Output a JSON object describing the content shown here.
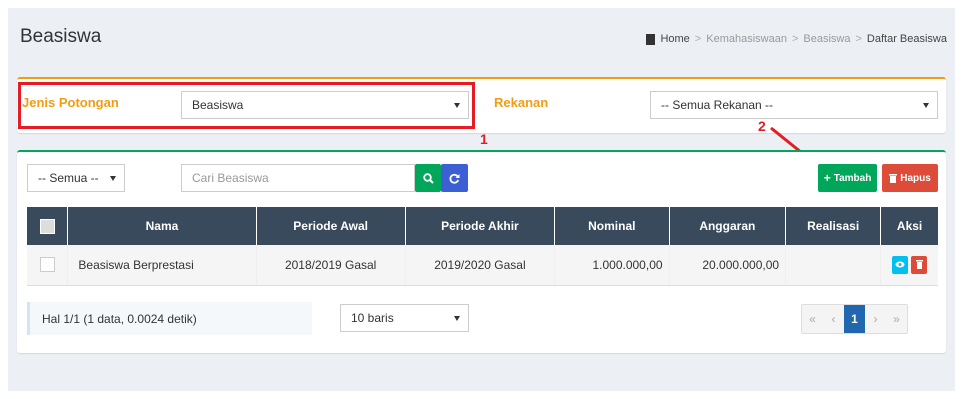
{
  "page": {
    "title": "Beasiswa",
    "breadcrumb": [
      "Home",
      "Kemahasiswaan",
      "Beasiswa",
      "Daftar Beasiswa"
    ]
  },
  "filter": {
    "jenis_label": "Jenis Potongan",
    "jenis_value": "Beasiswa",
    "rekanan_label": "Rekanan",
    "rekanan_value": "-- Semua Rekanan --"
  },
  "annotations": {
    "one": "1",
    "two": "2"
  },
  "toolbar": {
    "semua_value": "-- Semua --",
    "search_placeholder": "Cari Beasiswa",
    "tambah_label": "Tambah",
    "hapus_label": "Hapus"
  },
  "table": {
    "headers": [
      "Nama",
      "Periode Awal",
      "Periode Akhir",
      "Nominal",
      "Anggaran",
      "Realisasi",
      "Aksi"
    ],
    "rows": [
      {
        "nama": "Beasiswa Berprestasi",
        "periode_awal": "2018/2019 Gasal",
        "periode_akhir": "2019/2020 Gasal",
        "nominal": "1.000.000,00",
        "anggaran": "20.000.000,00",
        "realisasi": ""
      }
    ]
  },
  "footer": {
    "info": "Hal 1/1 (1 data, 0.0024 detik)",
    "rows_value": "10 baris",
    "pager": [
      "«",
      "‹",
      "1",
      "›",
      "»"
    ]
  },
  "colors": {
    "accent_orange": "#f39c12",
    "accent_green": "#00a65a",
    "annotation_red": "#e51c23",
    "header_dark": "#394a5d"
  }
}
